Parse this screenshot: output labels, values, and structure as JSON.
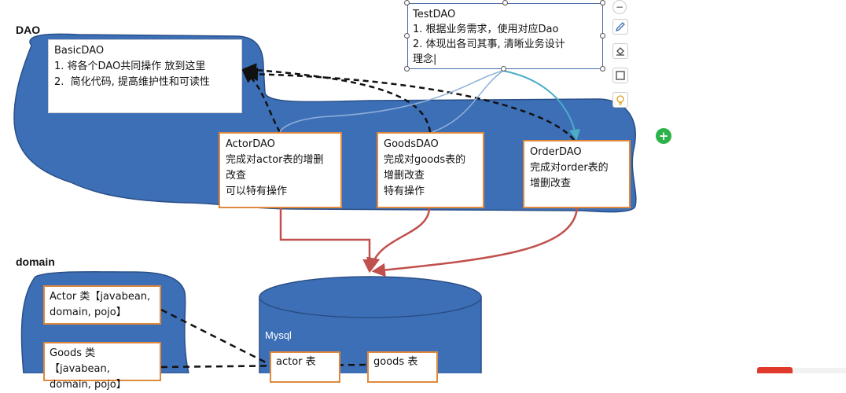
{
  "labels": {
    "dao": "DAO",
    "domain": "domain",
    "mysql": "Mysql"
  },
  "basic_dao": {
    "lines": [
      "BasicDAO",
      "1. 将各个DAO共同操作 放到这里",
      "2.  简化代码, 提高维护性和可读性"
    ]
  },
  "test_dao": {
    "lines": [
      "TestDAO",
      "1. 根据业务需求，使用对应Dao",
      "2. 体现出各司其事, 清晰业务设计",
      "理念|"
    ]
  },
  "actor_dao": {
    "lines": [
      "ActorDAO",
      "完成对actor表的增删",
      "改查",
      "可以特有操作"
    ]
  },
  "goods_dao": {
    "lines": [
      "GoodsDAO",
      "完成对goods表的",
      "增删改查",
      "特有操作"
    ]
  },
  "order_dao": {
    "lines": [
      "OrderDAO",
      "完成对order表的",
      "增删改查"
    ]
  },
  "domain_items": {
    "actor": [
      "Actor 类【javabean,",
      "domain, pojo】"
    ],
    "goods": [
      "Goods 类【javabean,",
      "domain, pojo】"
    ]
  },
  "tables": {
    "actor": "actor 表",
    "goods": "goods 表"
  },
  "toolbar": {
    "collapse": "−"
  },
  "colors": {
    "blob": "#3d6fb6",
    "blob_stroke": "#2a4f87",
    "orange_border": "#e0893c",
    "red_arrow": "#c0504d",
    "teal_arrow": "#4bacc6"
  }
}
